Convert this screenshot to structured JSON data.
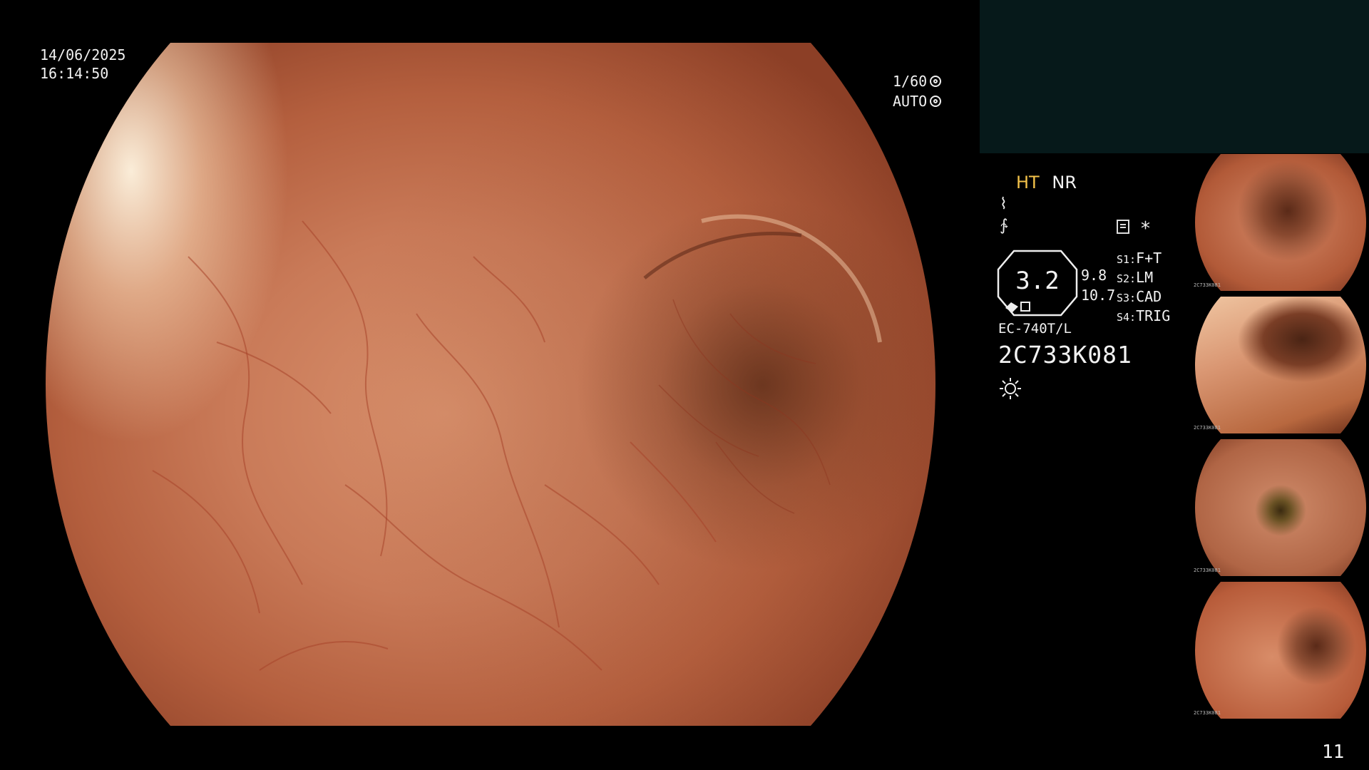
{
  "capture": {
    "date": "14/06/2025",
    "time": "16:14:50"
  },
  "exposure": {
    "shutter": "1/60",
    "mode": "AUTO"
  },
  "processing": {
    "mode_1": "HT",
    "mode_2": "NR"
  },
  "zoom": {
    "value": "3.2",
    "side_top": "9.8",
    "side_bottom": "10.7"
  },
  "switches": [
    {
      "key": "S1:",
      "value": "F+T"
    },
    {
      "key": "S2:",
      "value": "LM"
    },
    {
      "key": "S3:",
      "value": "CAD"
    },
    {
      "key": "S4:",
      "value": "TRIG"
    }
  ],
  "scope": {
    "model": "EC-740T/L",
    "serial": "2C733K081"
  },
  "icons": {
    "wave": "wave-icon",
    "filter": "filter-icon",
    "list": "list-icon",
    "asterisk": "asterisk-icon",
    "light": "light-icon",
    "shutter": "shutter-icon",
    "auto": "auto-icon"
  },
  "colors": {
    "ht_label": "#f3c24a",
    "top_panel": "#06191a",
    "mucosa": "#c97a58"
  },
  "thumbnails": [
    {
      "caption": "2C733K081"
    },
    {
      "caption": "2C733K081"
    },
    {
      "caption": "2C733K081"
    },
    {
      "caption": "2C733K081"
    }
  ],
  "page": "11"
}
